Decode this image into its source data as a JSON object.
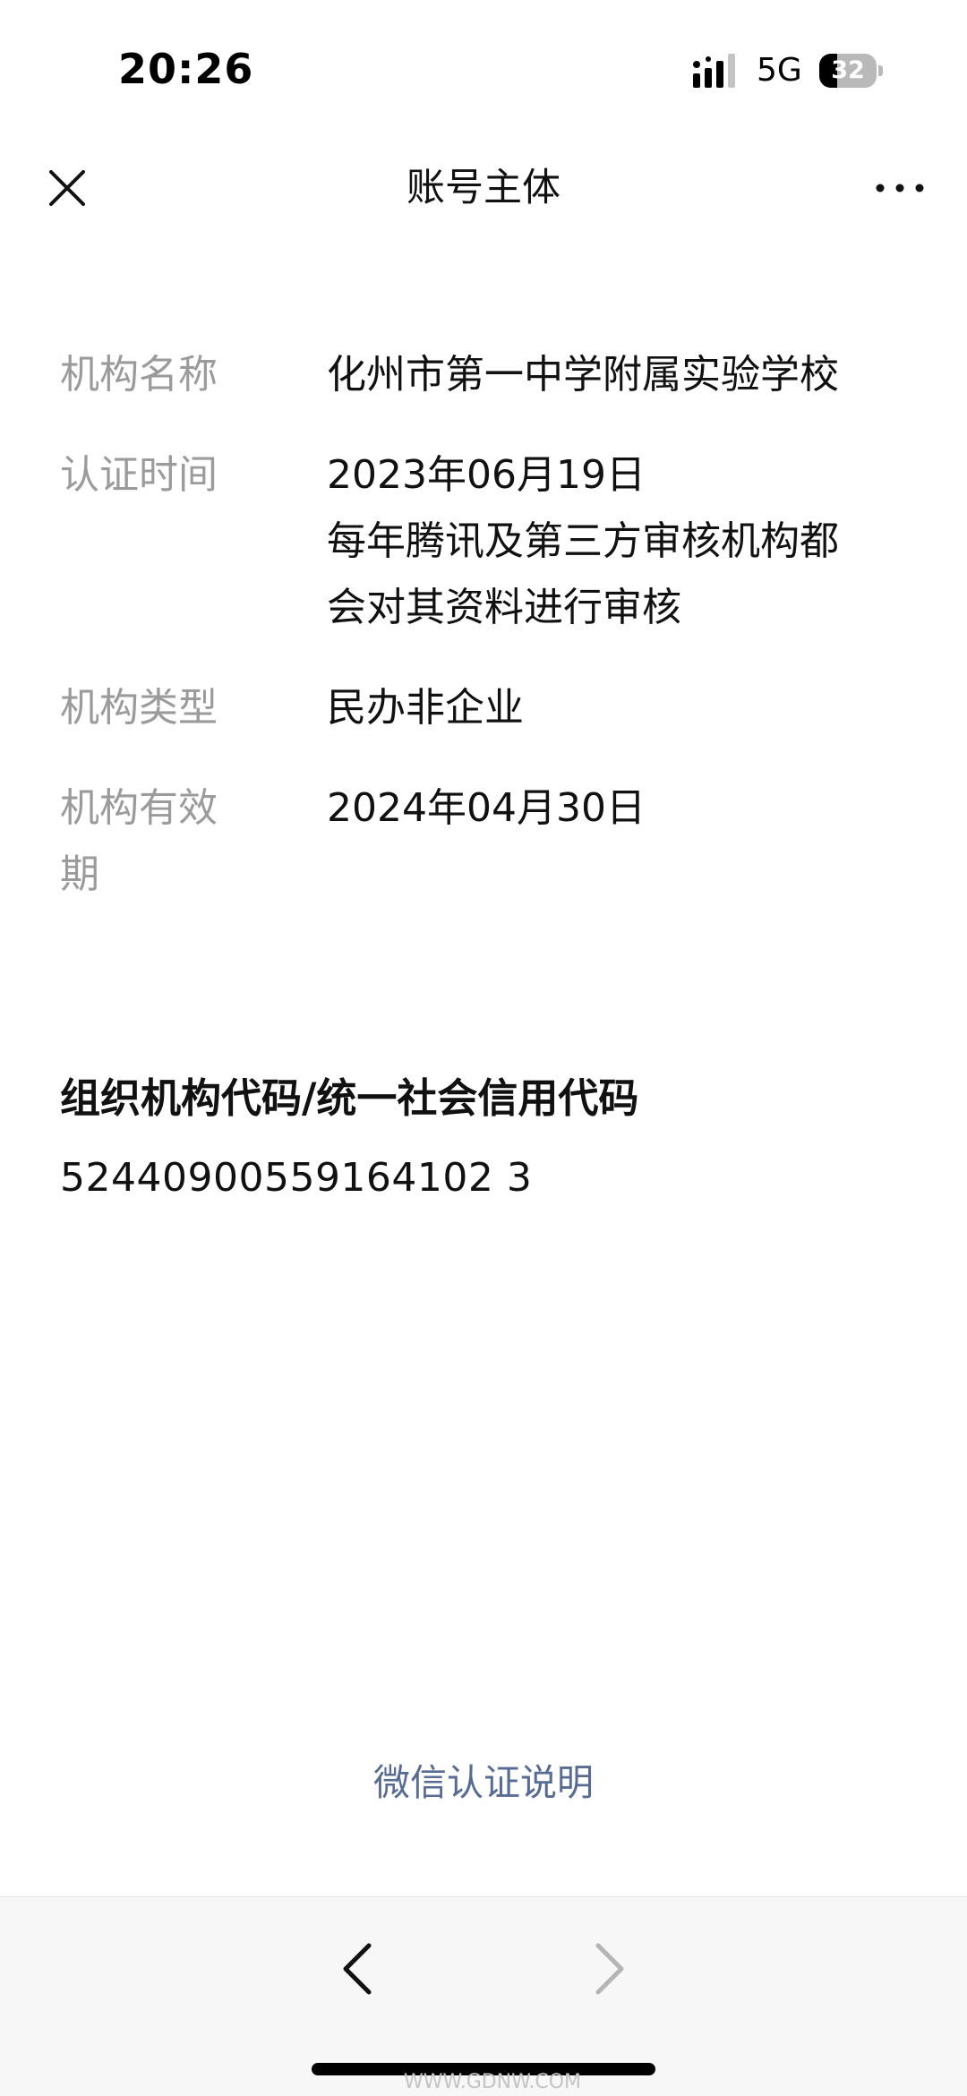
{
  "status_bar": {
    "time": "20:26",
    "network": "5G",
    "battery_level": "32",
    "battery_fraction": 0.32
  },
  "nav": {
    "title": "账号主体",
    "close_icon": "close-icon",
    "more_icon": "more-dots-icon"
  },
  "info": {
    "rows": [
      {
        "label": "机构名称",
        "lines": [
          "化州市第一中学附属实验学校"
        ]
      },
      {
        "label": "认证时间",
        "lines": [
          "2023年06月19日",
          "每年腾讯及第三方审核机构都",
          "会对其资料进行审核"
        ]
      },
      {
        "label": "机构类型",
        "lines": [
          "民办非企业"
        ]
      },
      {
        "label_lines": [
          "机构有效",
          "期"
        ],
        "lines": [
          "2024年04月30日"
        ]
      }
    ]
  },
  "code": {
    "title": "组织机构代码/统一社会信用代码",
    "value": "52440900559164102 3"
  },
  "footer": {
    "link": "微信认证说明"
  },
  "toolbar": {
    "back_icon": "chevron-left-icon",
    "forward_icon": "chevron-right-icon",
    "watermark": "WWW.GDNW.COM"
  },
  "colors": {
    "label": "#9b9b9b",
    "link": "#576b95",
    "toolbar_bg": "#f7f7f7"
  }
}
